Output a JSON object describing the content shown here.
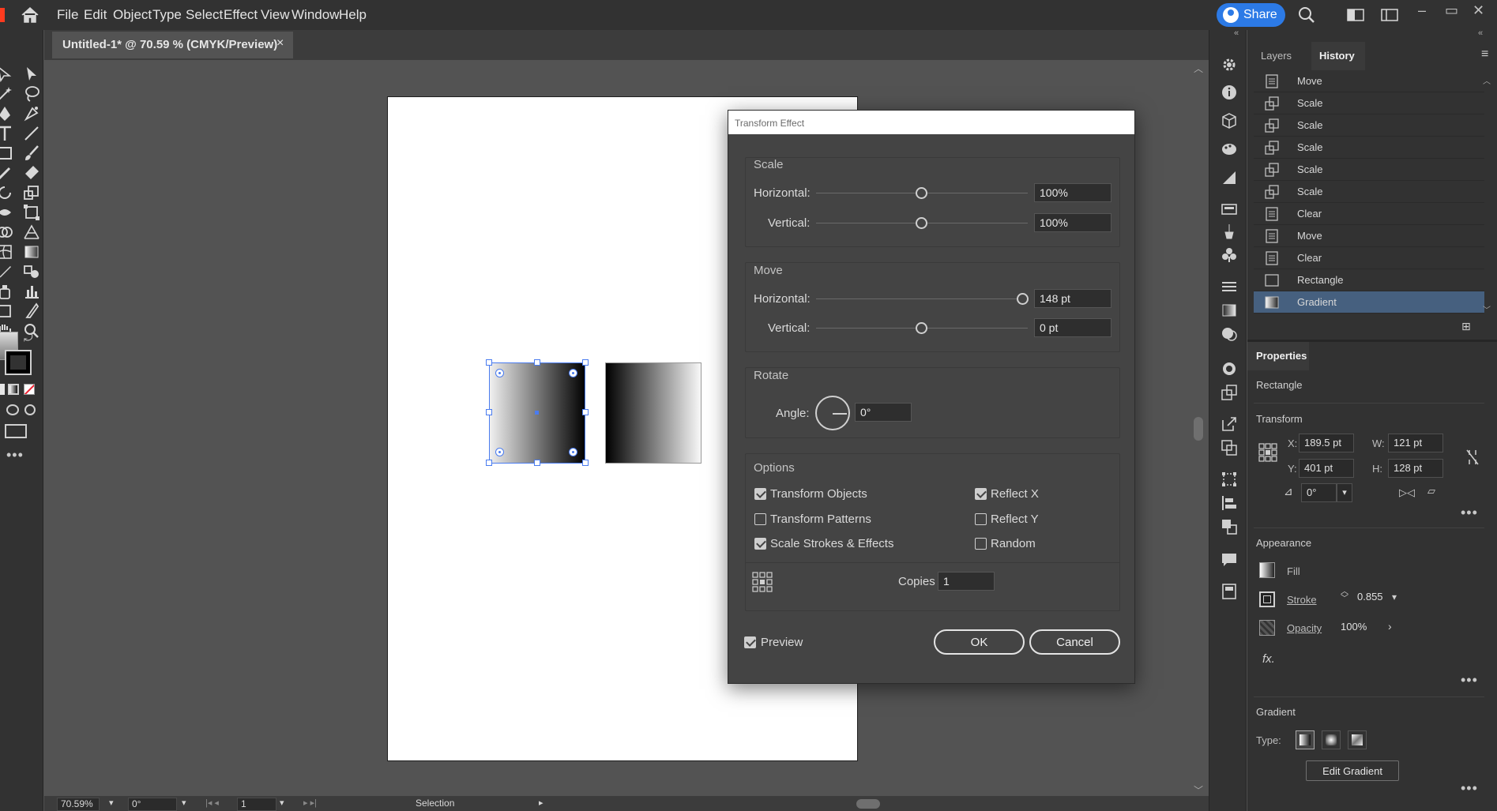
{
  "app": {
    "menu": [
      "File",
      "Edit",
      "Object",
      "Type",
      "Select",
      "Effect",
      "View",
      "Window",
      "Help"
    ],
    "share_label": "Share"
  },
  "document": {
    "tab_title": "Untitled-1* @ 70.59 % (CMYK/Preview)",
    "close_glyph": "×"
  },
  "dialog": {
    "title": "Transform Effect",
    "scale": {
      "section": "Scale",
      "horizontal_label": "Horizontal:",
      "horizontal_value": "100%",
      "vertical_label": "Vertical:",
      "vertical_value": "100%"
    },
    "move": {
      "section": "Move",
      "horizontal_label": "Horizontal:",
      "horizontal_value": "148 pt",
      "vertical_label": "Vertical:",
      "vertical_value": "0 pt"
    },
    "rotate": {
      "section": "Rotate",
      "angle_label": "Angle:",
      "angle_value": "0°"
    },
    "options": {
      "section": "Options",
      "transform_objects": "Transform Objects",
      "transform_patterns": "Transform Patterns",
      "scale_strokes": "Scale Strokes & Effects",
      "reflect_x": "Reflect X",
      "reflect_y": "Reflect Y",
      "random": "Random",
      "copies_label": "Copies",
      "copies_value": "1"
    },
    "preview_label": "Preview",
    "ok_label": "OK",
    "cancel_label": "Cancel"
  },
  "panels": {
    "tabs": [
      "Layers",
      "History"
    ],
    "history": [
      {
        "label": "Move",
        "icon": "document-icon"
      },
      {
        "label": "Scale",
        "icon": "scale-icon"
      },
      {
        "label": "Scale",
        "icon": "scale-icon"
      },
      {
        "label": "Scale",
        "icon": "scale-icon"
      },
      {
        "label": "Scale",
        "icon": "scale-icon"
      },
      {
        "label": "Scale",
        "icon": "scale-icon"
      },
      {
        "label": "Clear",
        "icon": "document-icon"
      },
      {
        "label": "Move",
        "icon": "document-icon"
      },
      {
        "label": "Clear",
        "icon": "document-icon"
      },
      {
        "label": "Rectangle",
        "icon": "rectangle-icon"
      },
      {
        "label": "Gradient",
        "icon": "gradient-icon"
      }
    ],
    "properties": {
      "tab": "Properties",
      "object_type": "Rectangle",
      "transform_label": "Transform",
      "x_label": "X:",
      "x_value": "189.5 pt",
      "y_label": "Y:",
      "y_value": "401 pt",
      "w_label": "W:",
      "w_value": "121 pt",
      "h_label": "H:",
      "h_value": "128 pt",
      "angle_value": "0°",
      "appearance_label": "Appearance",
      "fill_label": "Fill",
      "stroke_label": "Stroke",
      "stroke_value": "0.855",
      "opacity_label": "Opacity",
      "opacity_value": "100%",
      "fx_label": "fx.",
      "gradient_label": "Gradient",
      "type_label": "Type:",
      "edit_gradient_label": "Edit Gradient"
    }
  },
  "status": {
    "zoom": "70.59%",
    "rotation": "0°",
    "artboard": "1",
    "tool": "Selection"
  },
  "colors": {
    "accent": "#2c7ae6",
    "selection": "#4a7cf0",
    "history_selected": "#46607f"
  }
}
